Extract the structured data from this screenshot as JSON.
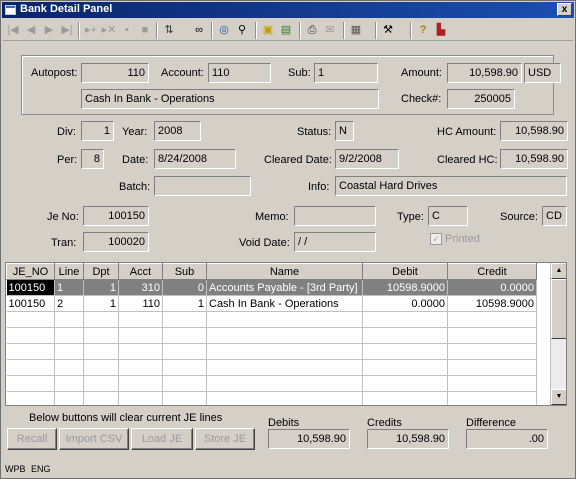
{
  "window": {
    "title": "Bank Detail Panel",
    "close_glyph": "x"
  },
  "toolbar": {
    "buttons": [
      "first-record-icon",
      "prev-record-icon",
      "next-record-icon",
      "last-record-icon",
      "add-record-icon",
      "delete-record-icon",
      "save-icon",
      "stop-icon",
      "sort-icon",
      "find-binoculars-icon",
      "zoom-icon",
      "search-icon",
      "image-icon",
      "document-icon",
      "print-icon",
      "mail-icon",
      "calculator-icon",
      "tools-icon",
      "help-icon",
      "exit-icon"
    ]
  },
  "header": {
    "autopost_label": "Autopost:",
    "autopost": "110",
    "account_label": "Account:",
    "account": "110",
    "sub_label": "Sub:",
    "sub": "1",
    "amount_label": "Amount:",
    "amount": "10,598.90",
    "currency": "USD",
    "account_desc": "Cash In Bank - Operations",
    "check_label": "Check#:",
    "check": "250005"
  },
  "detail": {
    "div_label": "Div:",
    "div": "1",
    "year_label": "Year:",
    "year": "2008",
    "status_label": "Status:",
    "status": "N",
    "hc_amount_label": "HC Amount:",
    "hc_amount": "10,598.90",
    "per_label": "Per:",
    "per": "8",
    "date_label": "Date:",
    "date": "8/24/2008",
    "cleared_date_label": "Cleared Date:",
    "cleared_date": "9/2/2008",
    "cleared_hc_label": "Cleared HC:",
    "cleared_hc": "10,598.90",
    "batch_label": "Batch:",
    "batch": "",
    "info_label": "Info:",
    "info": "Coastal Hard Drives",
    "je_no_label": "Je No:",
    "je_no": "100150",
    "memo_label": "Memo:",
    "memo": "",
    "type_label": "Type:",
    "type": "C",
    "source_label": "Source:",
    "source": "CD",
    "tran_label": "Tran:",
    "tran": "100020",
    "void_date_label": "Void Date:",
    "void_date": "/ /",
    "printed_label": "Printed",
    "printed_check": "✓"
  },
  "grid": {
    "columns": [
      "JE_NO",
      "Line",
      "Dpt",
      "Acct",
      "Sub",
      "Name",
      "Debit",
      "Credit"
    ],
    "rows": [
      [
        "100150",
        "1",
        "1",
        "310",
        "0",
        "Accounts Payable - [3rd Party]",
        "10598.9000",
        "0.0000"
      ],
      [
        "100150",
        "2",
        "1",
        "110",
        "1",
        "Cash In Bank - Operations",
        "0.0000",
        "10598.9000"
      ]
    ]
  },
  "footer": {
    "notice": "Below buttons will clear current JE lines",
    "recall": "Recall",
    "import_csv": "Import CSV",
    "load_je": "Load JE",
    "store_je": "Store JE",
    "debits_label": "Debits",
    "debits": "10,598.90",
    "credits_label": "Credits",
    "credits": "10,598.90",
    "difference_label": "Difference",
    "difference": ".00"
  },
  "statusbar": {
    "left": "WPB",
    "right": "ENG"
  }
}
